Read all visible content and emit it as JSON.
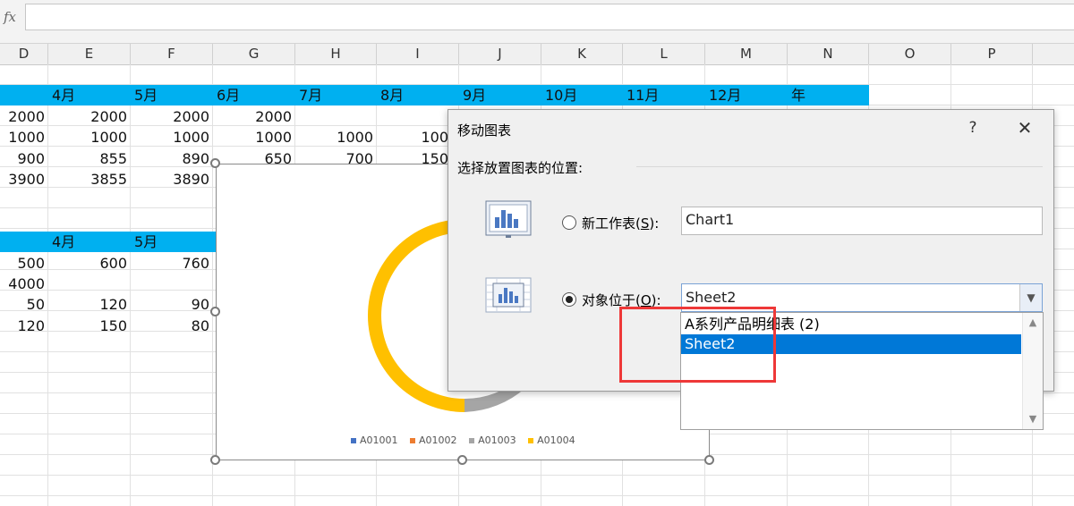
{
  "formula_bar": {
    "fx_label": "fx",
    "value": ""
  },
  "columns": [
    "D",
    "E",
    "F",
    "G",
    "H",
    "I",
    "J",
    "K",
    "L",
    "M",
    "N",
    "O",
    "P"
  ],
  "table1": {
    "header": [
      "4月",
      "5月",
      "6月",
      "7月",
      "8月",
      "9月",
      "10月",
      "11月",
      "12月",
      "年"
    ],
    "rows": [
      [
        "2000",
        "2000",
        "2000",
        "2000"
      ],
      [
        "1000",
        "1000",
        "1000",
        "1000",
        "1000",
        "100"
      ],
      [
        "900",
        "855",
        "890",
        "650",
        "700",
        "150"
      ],
      [
        "3900",
        "3855",
        "3890"
      ]
    ]
  },
  "table2": {
    "header": [
      "4月",
      "5月"
    ],
    "rows": [
      [
        "500",
        "600",
        "760"
      ],
      [
        "4000"
      ],
      [
        "50",
        "120",
        "90"
      ],
      [
        "120",
        "150",
        "80"
      ]
    ]
  },
  "chart": {
    "legend": [
      {
        "label": "A01001",
        "color": "#4472c4"
      },
      {
        "label": "A01002",
        "color": "#ed7d31"
      },
      {
        "label": "A01003",
        "color": "#a5a5a5"
      },
      {
        "label": "A01004",
        "color": "#ffc000"
      }
    ]
  },
  "dialog": {
    "title": "移动图表",
    "help_icon": "question-icon",
    "close_icon": "close-icon",
    "prompt": "选择放置图表的位置:",
    "option_new_sheet": {
      "label": "新工作表(",
      "mnemonic": "S",
      "suffix": "):",
      "value": "Chart1",
      "selected": false
    },
    "option_object_in": {
      "label": "对象位于(",
      "mnemonic": "O",
      "suffix": "):",
      "value": "Sheet2",
      "selected": true
    },
    "dropdown_options": [
      "A系列产品明细表 (2)",
      "Sheet2"
    ],
    "dropdown_selected": "Sheet2"
  },
  "colors": {
    "header_band": "#00b0f0",
    "selection": "#0078d7",
    "highlight_box": "#ee3838",
    "donut_main": "#ffc000",
    "donut_second": "#a5a5a5"
  }
}
